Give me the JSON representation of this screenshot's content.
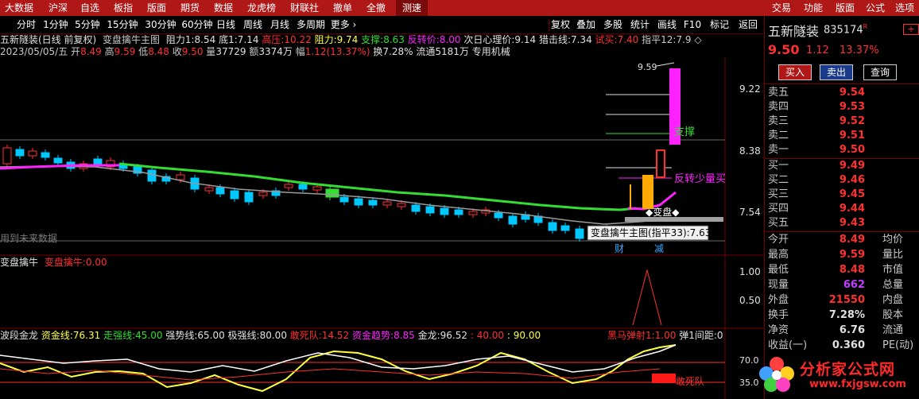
{
  "menu": {
    "left": [
      "大数据",
      "沪深",
      "自选",
      "板指",
      "版面",
      "期货",
      "数据",
      "龙虎榜",
      "财联社",
      "撤单",
      "全撤",
      "测速"
    ],
    "right": [
      "交易",
      "功能",
      "版面",
      "公式",
      "选项"
    ]
  },
  "toolbar": {
    "periods": [
      "分时",
      "1分钟",
      "5分钟",
      "15分钟",
      "30分钟",
      "60分钟",
      "日线",
      "周线",
      "月线",
      "多周期",
      "更多 ›"
    ],
    "tools": [
      "复权",
      "叠加",
      "多股",
      "统计",
      "画线",
      "F10",
      "标记",
      "返回"
    ]
  },
  "stock_info": {
    "title": "五新隧装(日线 前复权)",
    "indicator": "变盘擒牛主图",
    "resistance_label": "阻力1:",
    "resistance_val": "8.54",
    "bottom_label": "底1:",
    "bottom_val": "7.14",
    "high_press_label": "高压:",
    "high_press_val": "10.22",
    "resist2_label": "阻力:",
    "resist2_val": "9.74",
    "support_label": "支撑:",
    "support_val": "8.63",
    "reverse_label": "反转价:",
    "reverse_val": "8.00",
    "heart_label": "次日心理价:",
    "heart_val": "9.14",
    "attack_label": "猎击线:",
    "attack_val": "7.34",
    "trybuy_label": "试买:",
    "trybuy_val": "7.40",
    "zhiping_label": "指平12:",
    "zhiping_val": "7.9 ◇",
    "date": "2023/05/05/五",
    "open_label": "开",
    "open": "8.49",
    "high_label": "高",
    "high": "9.59",
    "low_label": "低",
    "low": "8.48",
    "close_label": "收",
    "close": "9.50",
    "vol_label": "量",
    "vol": "37729",
    "amount_label": "额",
    "amount": "3374万",
    "range_label": "幅",
    "range": "1.12(13.37%)",
    "turnover": "换7.28%",
    "float": "流通5181万",
    "industry": "专用机械"
  },
  "chart_labels": {
    "price_9_22": "9.22",
    "price_8_38": "8.38",
    "price_7_54": "7.54",
    "high_mark": "9.59",
    "support": "支撑",
    "reverse_small": "反转少量买",
    "biangpan": "◆变盘◆",
    "cai": "财",
    "jian": "减",
    "future_data": "用到未来数据",
    "tooltip": "变盘擒牛主图(指平33):7.63"
  },
  "sub1": {
    "title": "变盘擒牛",
    "name": "变盘擒牛:",
    "value": "0.00",
    "axis_top": "1.00",
    "axis_bottom": "0.50"
  },
  "sub2": {
    "title": "波段金龙",
    "zijin_label": "资金线:",
    "zijin": "76.31",
    "zouqiang_label": "走强线:",
    "zouqiang": "45.00",
    "qiangshi_label": "强势线:",
    "qiangshi": "65.00",
    "jiqiang_label": "极强线:",
    "jiqiang": "80.00",
    "gansi_label": "敢死队:",
    "gansi": "14.52",
    "trend_label": "资金趋势:",
    "trend": "8.85",
    "jinlong_label": "金龙:",
    "jinlong": "96.52",
    "v40": ": 40.00",
    "v90": ": 90.00",
    "heima_label": "黑马弹射1:",
    "heima": "1.00",
    "tan_label": "弹1间距:",
    "tan": "0",
    "axis_70": "70.0",
    "axis_35": "35.0",
    "gansi_tag": "敢死队"
  },
  "quote": {
    "name": "五新隧装",
    "code": "835174",
    "code_sup": "R",
    "price": "9.50",
    "change": "1.12",
    "pct": "13.37%",
    "buy_btn": "买入",
    "sell_btn": "卖出",
    "query_btn": "查询",
    "sells": [
      {
        "label": "卖五",
        "price": "9.54"
      },
      {
        "label": "卖四",
        "price": "9.53"
      },
      {
        "label": "卖三",
        "price": "9.52"
      },
      {
        "label": "卖二",
        "price": "9.51"
      },
      {
        "label": "卖一",
        "price": "9.50"
      }
    ],
    "buys": [
      {
        "label": "买一",
        "price": "9.49"
      },
      {
        "label": "买二",
        "price": "9.46"
      },
      {
        "label": "买三",
        "price": "9.45"
      },
      {
        "label": "买四",
        "price": "9.44"
      },
      {
        "label": "买五",
        "price": "9.43"
      }
    ],
    "stats": [
      {
        "label": "今开",
        "value": "8.49",
        "label2": "均价",
        "color": "#ff3030"
      },
      {
        "label": "最高",
        "value": "9.59",
        "label2": "量比",
        "color": "#ff3030"
      },
      {
        "label": "最低",
        "value": "8.48",
        "label2": "市值",
        "color": "#ff3030"
      },
      {
        "label": "现量",
        "value": "662",
        "label2": "总量",
        "color": "#c040ff"
      },
      {
        "label": "外盘",
        "value": "21550",
        "label2": "内盘",
        "color": "#ff3030"
      },
      {
        "label": "换手",
        "value": "7.28%",
        "label2": "股本",
        "color": "#e0e0e0"
      },
      {
        "label": "净资",
        "value": "6.76",
        "label2": "流通",
        "color": "#e0e0e0"
      },
      {
        "label": "收益(一)",
        "value": "0.360",
        "label2": "PE(动)",
        "color": "#e0e0e0"
      }
    ]
  },
  "watermark": {
    "site": "分析家公式网",
    "url": "www.fxjgsw.com"
  },
  "colors": {
    "menu_bg": "#b01818",
    "up": "#ff3030",
    "down": "#00c8ff",
    "green_ma": "#33dd33",
    "magenta": "#ff22ff"
  }
}
